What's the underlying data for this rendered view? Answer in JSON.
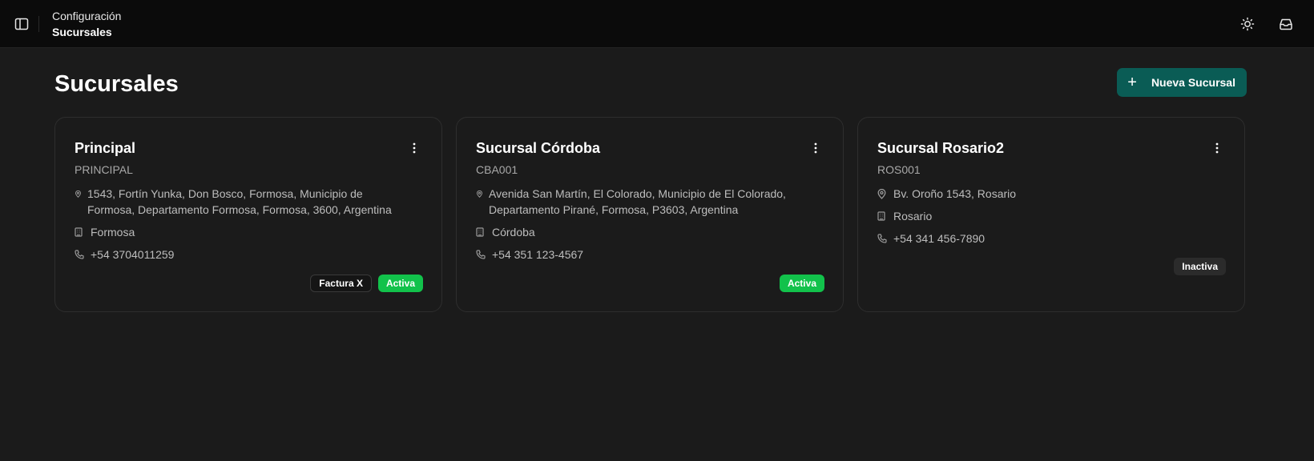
{
  "topbar": {
    "breadcrumb_parent": "Configuración",
    "breadcrumb_current": "Sucursales"
  },
  "page": {
    "title": "Sucursales",
    "new_button_label": "Nueva Sucursal"
  },
  "colors": {
    "accent": "#0a5c55",
    "active_badge": "#12c24b",
    "inactive_badge": "#2b2b2b"
  },
  "branches": [
    {
      "name": "Principal",
      "code": "PRINCIPAL",
      "address": "1543, Fortín Yunka, Don Bosco, Formosa, Municipio de Formosa, Departamento Formosa, Formosa, 3600, Argentina",
      "city": "Formosa",
      "phone": "+54 3704011259",
      "extra_badge": "Factura X",
      "status": "Activa"
    },
    {
      "name": "Sucursal Córdoba",
      "code": "CBA001",
      "address": "Avenida San Martín, El Colorado, Municipio de El Colorado, Departamento Pirané, Formosa, P3603, Argentina",
      "city": "Córdoba",
      "phone": "+54 351 123-4567",
      "status": "Activa"
    },
    {
      "name": "Sucursal Rosario2",
      "code": "ROS001",
      "address": "Bv. Oroño 1543, Rosario",
      "city": "Rosario",
      "phone": "+54 341 456-7890",
      "status": "Inactiva"
    }
  ]
}
